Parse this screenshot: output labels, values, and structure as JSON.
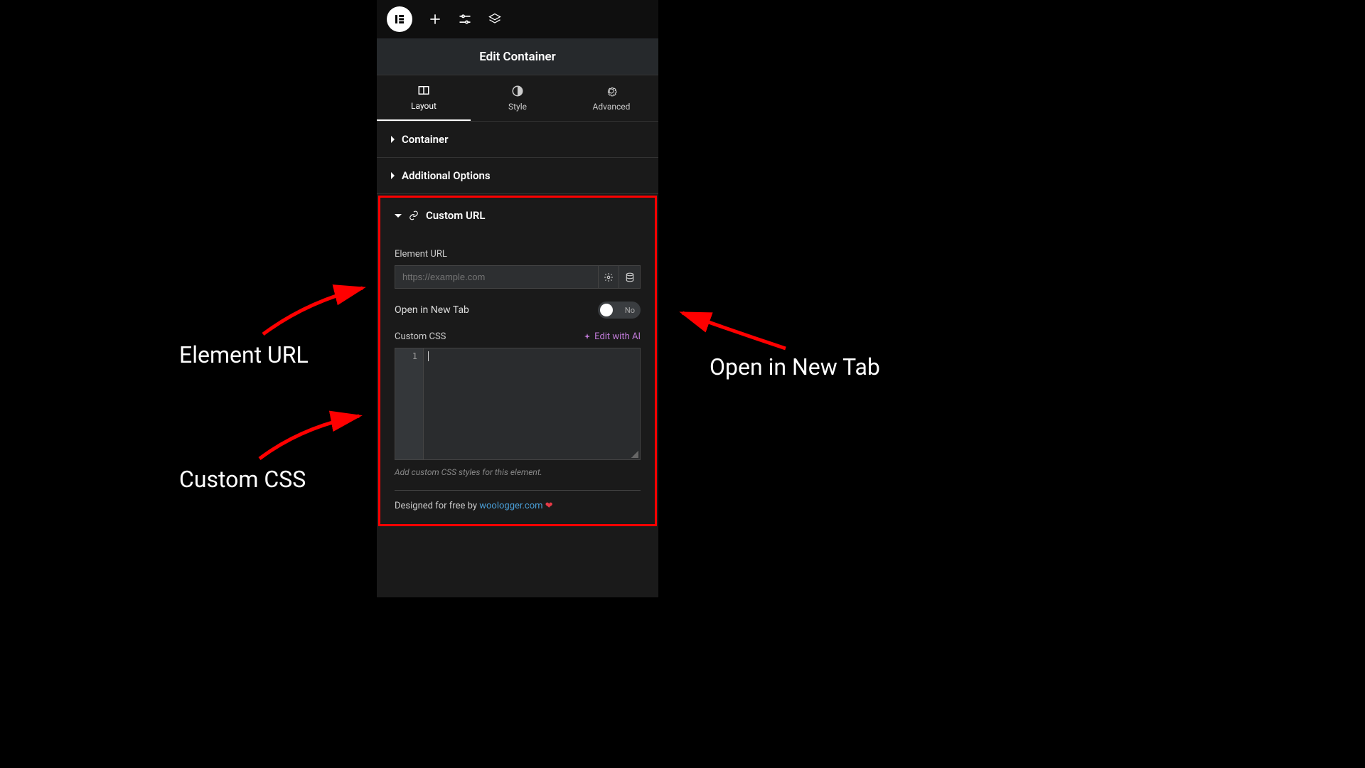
{
  "header": {
    "title": "Edit Container"
  },
  "tabs": {
    "layout": "Layout",
    "style": "Style",
    "advanced": "Advanced"
  },
  "accordions": {
    "container": "Container",
    "additional_options": "Additional Options",
    "custom_url": "Custom URL"
  },
  "custom_url": {
    "element_url_label": "Element URL",
    "element_url_placeholder": "https://example.com",
    "open_new_tab_label": "Open in New Tab",
    "open_new_tab_state": "No",
    "custom_css_label": "Custom CSS",
    "edit_ai_label": "Edit with AI",
    "line_number": "1",
    "hint": "Add custom CSS styles for this element.",
    "footer_prefix": "Designed for free by ",
    "footer_link": "woologger.com"
  },
  "annotations": {
    "element_url": "Element URL",
    "custom_css": "Custom CSS",
    "open_new_tab": "Open in New Tab"
  }
}
